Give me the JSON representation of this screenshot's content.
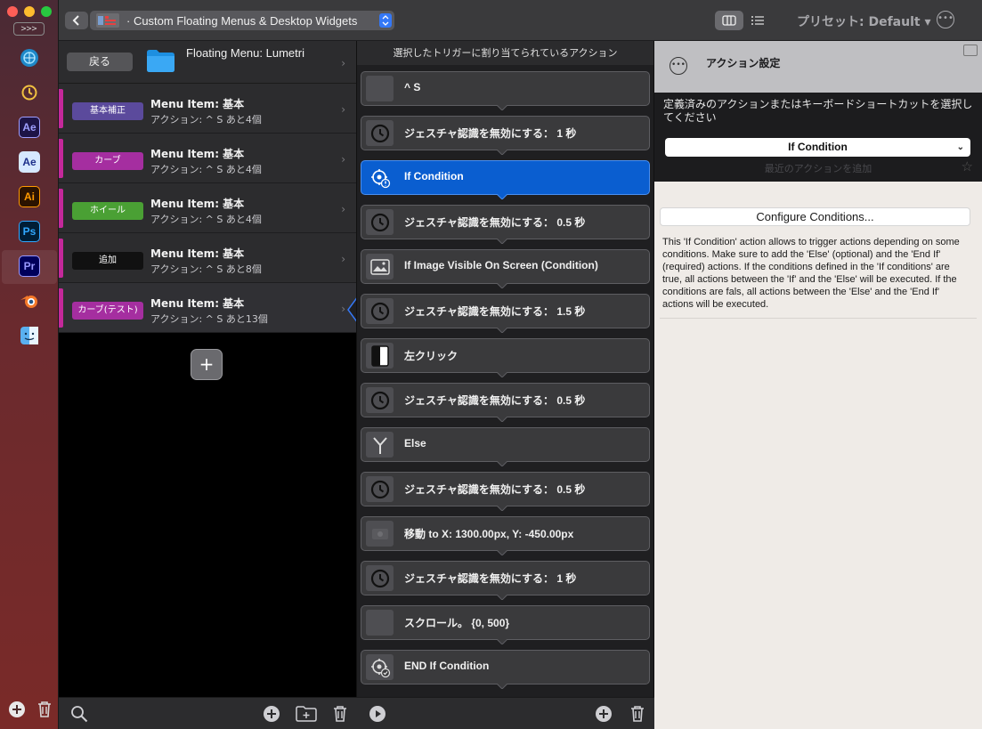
{
  "window": {
    "title": "· Custom Floating Menus & Desktop Widgets",
    "preset": "プリセット: Default ▾"
  },
  "dock": {
    "toggle_label": ">>>",
    "apps": [
      {
        "name": "network",
        "label": ""
      },
      {
        "name": "timer",
        "label": ""
      },
      {
        "name": "after-effects",
        "label": "Ae"
      },
      {
        "name": "after-effects-beta",
        "label": "Ae"
      },
      {
        "name": "illustrator",
        "label": "Ai"
      },
      {
        "name": "photoshop",
        "label": "Ps"
      },
      {
        "name": "premiere",
        "label": "Pr"
      },
      {
        "name": "blender",
        "label": ""
      },
      {
        "name": "finder",
        "label": ""
      }
    ]
  },
  "left_pane": {
    "back_label": "戻る",
    "menu_title": "Floating Menu: Lumetri",
    "items": [
      {
        "tag": "基本補正",
        "tag_color": "#5b4a9c",
        "stripe": "#c4289a",
        "title": "Menu Item: 基本",
        "subtitle": "アクション: ^ S あと4個"
      },
      {
        "tag": "カーブ",
        "tag_color": "#a52ea0",
        "stripe": "#c4289a",
        "title": "Menu Item: 基本",
        "subtitle": "アクション: ^ S あと4個"
      },
      {
        "tag": "ホイール",
        "tag_color": "#4aa034",
        "stripe": "#c4289a",
        "title": "Menu Item: 基本",
        "subtitle": "アクション: ^ S あと4個"
      },
      {
        "tag": "追加",
        "tag_color": "#111111",
        "stripe": "#c4289a",
        "title": "Menu Item: 基本",
        "subtitle": "アクション: ^ S あと8個"
      },
      {
        "tag": "カーブ(テスト)",
        "tag_color": "#a52ea0",
        "stripe": "#c4289a",
        "title": "Menu Item: 基本",
        "subtitle": "アクション: ^ S あと13個"
      }
    ]
  },
  "middle_pane": {
    "header": "選択したトリガーに割り当てられているアクション",
    "actions": [
      {
        "icon": "blank",
        "label": "^ S"
      },
      {
        "icon": "clock",
        "label": "ジェスチャ認識を無効にする： 1 秒"
      },
      {
        "icon": "condition",
        "label": "If Condition",
        "active": true
      },
      {
        "icon": "clock",
        "label": "ジェスチャ認識を無効にする： 0.5 秒"
      },
      {
        "icon": "image",
        "label": "If Image Visible On Screen (Condition)"
      },
      {
        "icon": "clock",
        "label": "ジェスチャ認識を無効にする： 1.5 秒"
      },
      {
        "icon": "click",
        "label": "左クリック"
      },
      {
        "icon": "clock",
        "label": "ジェスチャ認識を無効にする： 0.5 秒"
      },
      {
        "icon": "branch",
        "label": "Else"
      },
      {
        "icon": "clock",
        "label": "ジェスチャ認識を無効にする： 0.5 秒"
      },
      {
        "icon": "move",
        "label": "移動 to  X: 1300.00px, Y: -450.00px"
      },
      {
        "icon": "clock",
        "label": "ジェスチャ認識を無効にする： 1 秒"
      },
      {
        "icon": "blank",
        "label": "スクロール。 {0, 500}"
      },
      {
        "icon": "condition-end",
        "label": "END If Condition"
      }
    ]
  },
  "right_pane": {
    "title": "アクション設定",
    "description": "定義済みのアクションまたはキーボードショートカットを選択してください",
    "selected_action": "If Condition",
    "faded_hint": "最近のアクションを追加",
    "configure_label": "Configure Conditions...",
    "body_text": "This 'If Condition' action allows to trigger actions depending on some conditions. Make sure to add the 'Else' (optional) and the 'End If' (required) actions. If the conditions defined in the 'If conditions' are true, all actions between the 'If' and the 'Else' will be executed. If the conditions are fals, all actions between the 'Else' and the 'End If' actions will be executed."
  },
  "colors": {
    "accent": "#0a5ed0",
    "active_border": "#4a8ff0"
  }
}
